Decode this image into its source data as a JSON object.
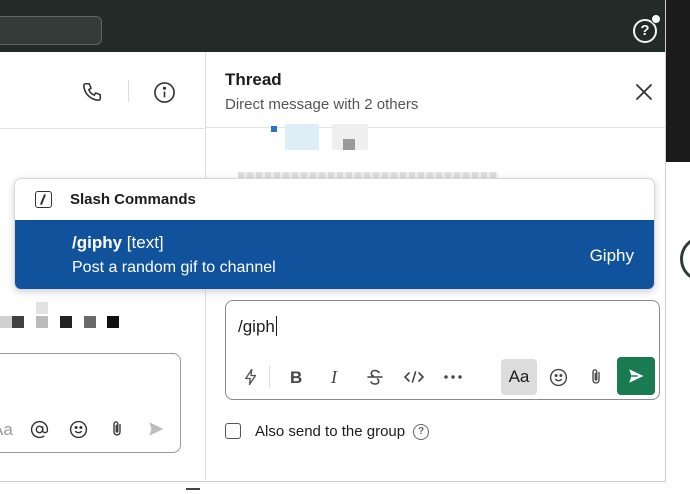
{
  "thread": {
    "title": "Thread",
    "subtitle": "Direct message with 2 others"
  },
  "slash_commands": {
    "header": "Slash Commands",
    "items": [
      {
        "command": "/giphy",
        "args": "[text]",
        "description": "Post a random gif to channel",
        "app": "Giphy"
      }
    ]
  },
  "composer": {
    "value": "/giph",
    "format_label": "Aa"
  },
  "left_composer": {
    "format_label": "Aa"
  },
  "also_send": {
    "label": "Also send to the group",
    "checked": false
  },
  "help": {
    "glyph": "?"
  },
  "colors": {
    "topbar": "#222b28",
    "highlight": "#11529c",
    "send": "#1a7a52"
  }
}
